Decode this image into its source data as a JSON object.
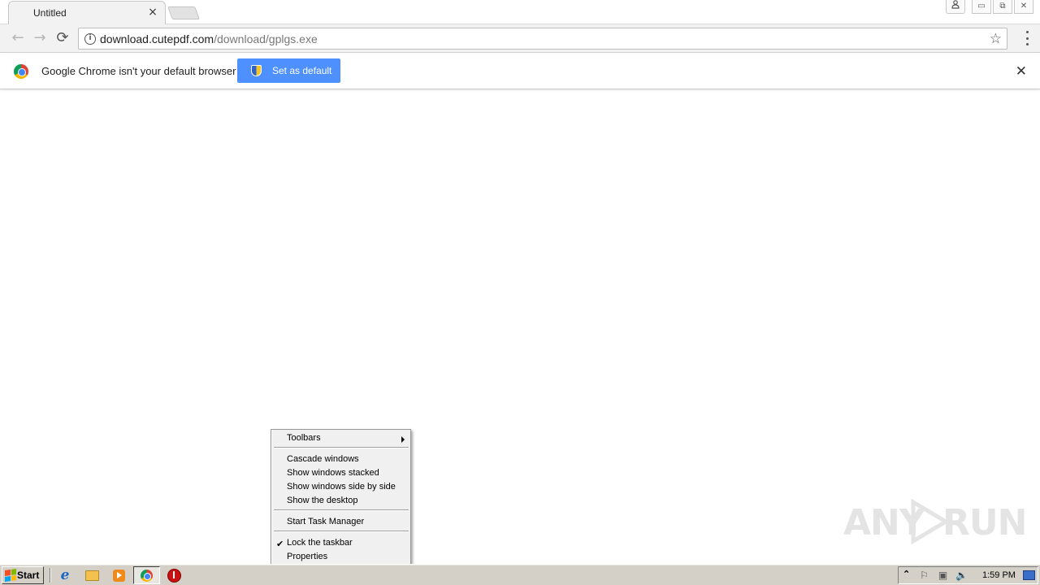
{
  "browser": {
    "tab": {
      "title": "Untitled",
      "close_glyph": "×"
    },
    "window_controls": {
      "profile_icon": "person-icon",
      "minimize": "▭",
      "restore": "⧉",
      "close": "✕"
    },
    "toolbar": {
      "back_icon": "←",
      "forward_icon": "→",
      "reload_icon": "⟳",
      "url_host": "download.cutepdf.com",
      "url_path": "/download/gplgs.exe",
      "info_icon": "i",
      "star_icon": "☆"
    },
    "infobar": {
      "message": "Google Chrome isn't your default browser",
      "button_label": "Set as default",
      "close_glyph": "✕"
    }
  },
  "context_menu": {
    "items": [
      {
        "label": "Toolbars",
        "submenu": true
      },
      {
        "label": "Cascade windows"
      },
      {
        "label": "Show windows stacked"
      },
      {
        "label": "Show windows side by side"
      },
      {
        "label": "Show the desktop"
      },
      {
        "label": "Start Task Manager"
      },
      {
        "label": "Lock the taskbar",
        "checked": true,
        "check_glyph": "✔"
      },
      {
        "label": "Properties"
      }
    ]
  },
  "taskbar": {
    "start_label": "Start",
    "ie_glyph": "e",
    "tray": {
      "up_glyph": "⌃",
      "flag_glyph": "⚐",
      "net_glyph": "▣",
      "volume_glyph": "🔈",
      "time": "1:59 PM"
    }
  },
  "watermark": {
    "text_left": "ANY",
    "text_right": "RUN"
  },
  "colors": {
    "accent": "#4d90fe",
    "taskbar": "#d4d0c8",
    "menu_bg": "#f0f0f0"
  }
}
